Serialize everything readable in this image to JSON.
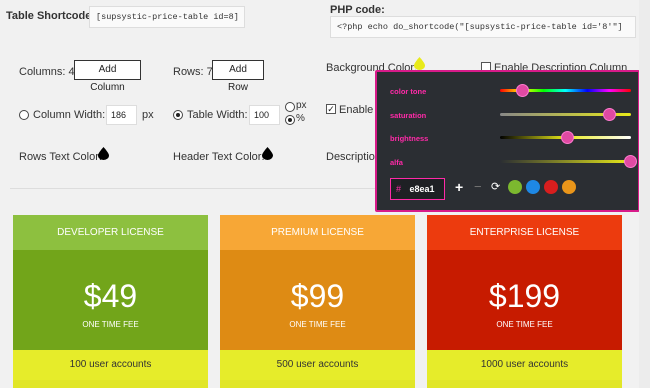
{
  "shortcode": {
    "label": "Table Shortcode:",
    "value": "[supsystic-price-table id=8]"
  },
  "php": {
    "label": "PHP code:",
    "value": "<?php echo do_shortcode(\"[supsystic-price-table id='8'\"]"
  },
  "columns": {
    "label": "Columns: 4",
    "add_label": "Add Column"
  },
  "rows": {
    "label": "Rows: 7",
    "add_label": "Add Row"
  },
  "bg_color": {
    "label": "Background Color:"
  },
  "enable_desc_col": {
    "label": "Enable Description Column"
  },
  "col_width": {
    "label": "Column Width:",
    "value": "186",
    "unit": "px"
  },
  "table_width": {
    "label": "Table Width:",
    "value": "100",
    "unit_px": "px",
    "unit_pct": "%"
  },
  "enable_trunc": {
    "label": "Enable"
  },
  "rows_text_color": {
    "label": "Rows Text Color:"
  },
  "header_text_color": {
    "label": "Header Text Color:"
  },
  "description_trunc": {
    "label": "Description"
  },
  "picker": {
    "labels": {
      "tone": "color tone",
      "saturation": "saturation",
      "brightness": "brightness",
      "alfa": "alfa"
    },
    "hex_prefix": "#",
    "hex_value": "e8ea1",
    "add_symbol": "+",
    "remove_symbol": "−",
    "refresh_symbol": "⟳",
    "swatches": [
      "#7cb82f",
      "#1e88e5",
      "#d81e1e",
      "#e9951a"
    ],
    "accent": "#ff2aa8"
  },
  "plans": [
    {
      "name": "DEVELOPER LICENSE",
      "price": "$49",
      "fee": "ONE TIME FEE",
      "feature": "100 user accounts",
      "head_color": "#8dc03f",
      "body_color": "#72a51a"
    },
    {
      "name": "PREMIUM LICENSE",
      "price": "$99",
      "fee": "ONE TIME FEE",
      "feature": "500 user accounts",
      "head_color": "#f7a736",
      "body_color": "#de8b14"
    },
    {
      "name": "ENTERPRISE LICENSE",
      "price": "$199",
      "fee": "ONE TIME FEE",
      "feature": "1000 user accounts",
      "head_color": "#ec3b0e",
      "body_color": "#c71b00"
    }
  ]
}
